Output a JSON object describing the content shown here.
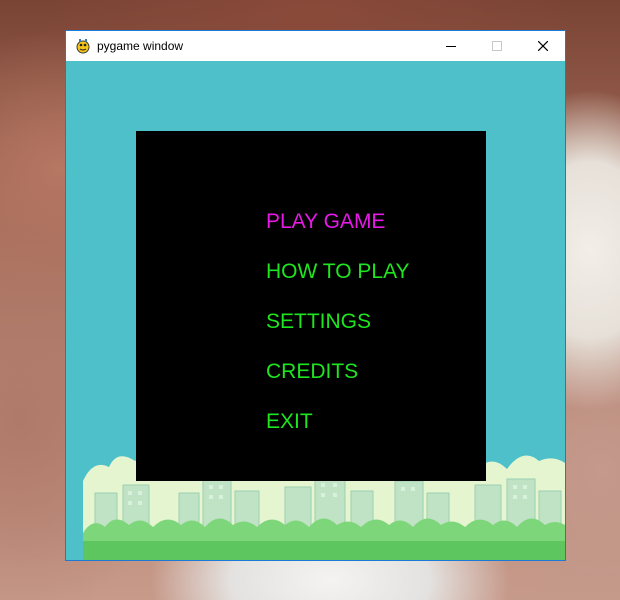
{
  "window": {
    "title": "pygame window"
  },
  "menu": {
    "items": [
      {
        "label": "PLAY GAME",
        "selected": true
      },
      {
        "label": "HOW TO PLAY",
        "selected": false
      },
      {
        "label": "SETTINGS",
        "selected": false
      },
      {
        "label": "CREDITS",
        "selected": false
      },
      {
        "label": "EXIT",
        "selected": false
      }
    ]
  },
  "colors": {
    "sky": "#4ec0ca",
    "panel": "#000000",
    "menu_text": "#1ee61e",
    "menu_selected": "#e619e6",
    "window_border": "#1b7ad8"
  },
  "icons": {
    "app": "pygame-snake-icon",
    "minimize": "minimize-icon",
    "maximize": "maximize-icon",
    "close": "close-icon"
  }
}
